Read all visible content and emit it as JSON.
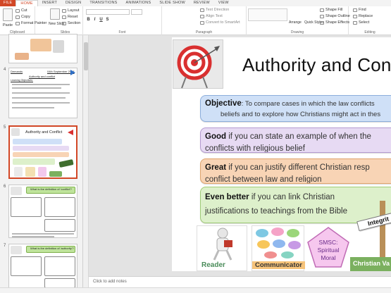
{
  "ribbon_tabs": [
    "FILE",
    "HOME",
    "INSERT",
    "DESIGN",
    "TRANSITIONS",
    "ANIMATIONS",
    "SLIDE SHOW",
    "REVIEW",
    "VIEW"
  ],
  "clipboard": {
    "paste": "Paste",
    "cut": "Cut",
    "copy": "Copy",
    "format_painter": "Format Painter",
    "label": "Clipboard"
  },
  "slides_group": {
    "new_slide": "New Slide",
    "layout": "Layout",
    "reset": "Reset",
    "section": "Section",
    "label": "Slides"
  },
  "font_group": {
    "label": "Font",
    "bold": "B",
    "italic": "I",
    "underline": "U",
    "strike": "S"
  },
  "paragraph_group": {
    "text_direction": "Text Direction",
    "align_text": "Align Text",
    "convert_smartart": "Convert to SmartArt",
    "label": "Paragraph"
  },
  "drawing_group": {
    "arrange": "Arrange",
    "quick_styles": "Quick Styles",
    "shape_fill": "Shape Fill",
    "shape_outline": "Shape Outline",
    "shape_effects": "Shape Effects",
    "label": "Drawing"
  },
  "editing_group": {
    "find": "Find",
    "replace": "Replace",
    "select": "Select",
    "label": "Editing"
  },
  "thumbnails": [
    {
      "number": "4",
      "heading_left": "Demands",
      "heading_right": "04th September 2017",
      "subtitle": "Authority and conflict",
      "sub2": "Learning Objectives:"
    },
    {
      "number": "5",
      "title": "Authority and Conflict"
    },
    {
      "number": "6",
      "title": "What is the definition of 'conflict'?"
    },
    {
      "number": "7",
      "title": "What is the definition of 'authority'?"
    }
  ],
  "slide": {
    "title": "Authority and Confli",
    "objective_label": "Objective",
    "objective_line1": ": To compare cases in which the law conflicts",
    "objective_line2": "beliefs and to explore how Christians might act in thes",
    "good_label": "Good",
    "good_line1": " if you can state an example of when the",
    "good_line2": "conflicts with religious belief",
    "great_label": "Great",
    "great_line1": " if you can justify different Christian resp",
    "great_line2": "conflict between law and religion",
    "even_label": "Even better",
    "even_line1": " if you can link Christian",
    "even_line2": "justifications to teachings from the Bible",
    "reader": "Reader",
    "communicator": "Communicator",
    "smsc_line1": "SMSC:",
    "smsc_line2": "Spiritual",
    "smsc_line3": "Moral",
    "christian": "Christian Va",
    "integrity": "Integrit"
  },
  "notes_placeholder": "Click to add notes",
  "colors": {
    "accent": "#d24726",
    "objective": "#cfe0f7",
    "good": "#e7daf3",
    "great": "#f8d4b5",
    "even": "#ddf0cb"
  }
}
